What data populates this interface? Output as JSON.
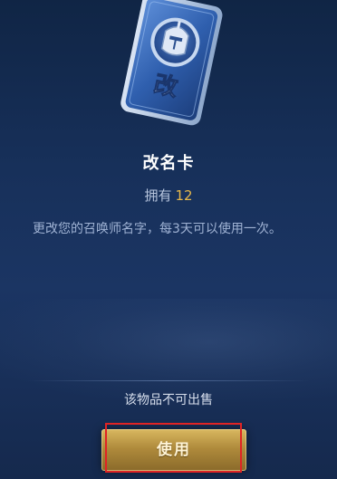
{
  "item": {
    "card_glyph": "改",
    "card_icon": "helmet-icon",
    "name": "改名卡",
    "owned_label": "拥有",
    "owned_count": "12",
    "description": "更改您的召唤师名字，每3天可以使用一次。",
    "sale_note": "该物品不可出售",
    "use_label": "使用"
  },
  "colors": {
    "accent_gold": "#e8b84a",
    "button_gold": "#b08b3c",
    "highlight_red": "#e02424",
    "card_blue": "#2f5fae"
  }
}
